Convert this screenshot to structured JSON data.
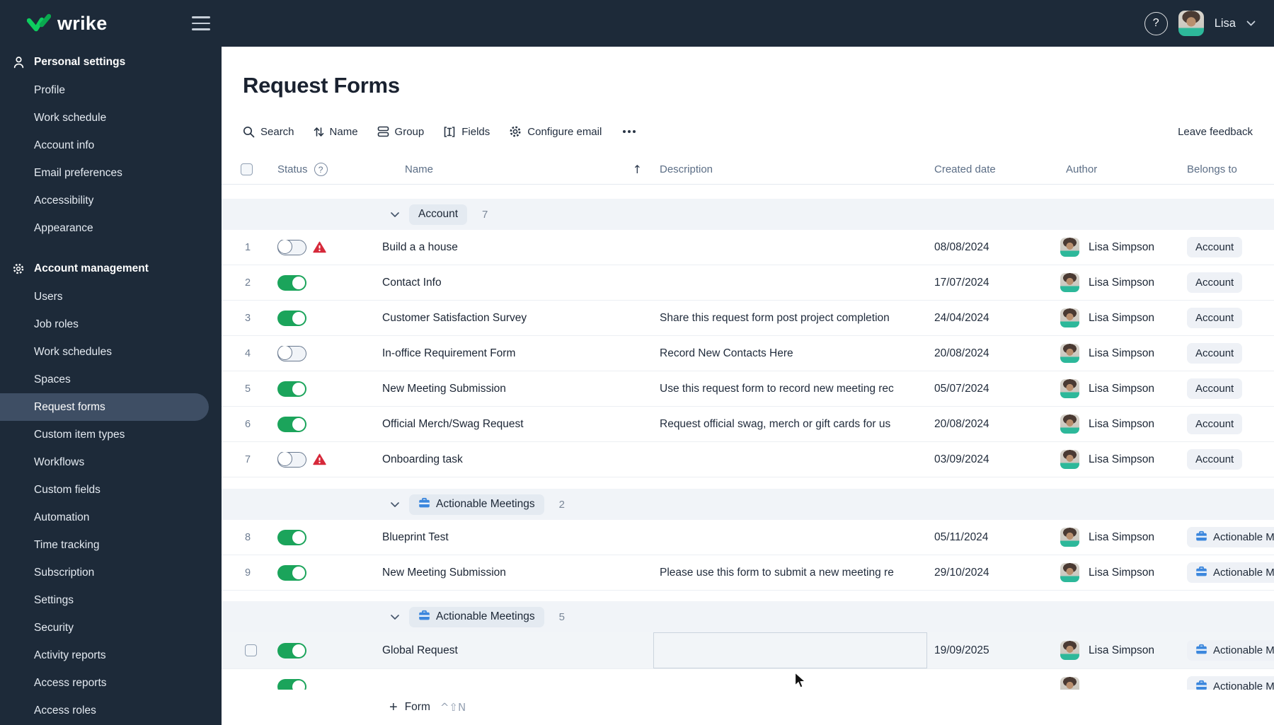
{
  "topbar": {
    "brand": "wrike",
    "user_name": "Lisa",
    "help_icon": "question-circle-icon",
    "menu_icon": "hamburger-icon"
  },
  "sidebar": {
    "sections": [
      {
        "title": "Personal settings",
        "icon": "person-icon",
        "items": [
          {
            "label": "Profile"
          },
          {
            "label": "Work schedule"
          },
          {
            "label": "Account info"
          },
          {
            "label": "Email preferences"
          },
          {
            "label": "Accessibility"
          },
          {
            "label": "Appearance"
          }
        ]
      },
      {
        "title": "Account management",
        "icon": "gear-icon",
        "items": [
          {
            "label": "Users"
          },
          {
            "label": "Job roles"
          },
          {
            "label": "Work schedules"
          },
          {
            "label": "Spaces"
          },
          {
            "label": "Request forms",
            "active": true
          },
          {
            "label": "Custom item types"
          },
          {
            "label": "Workflows"
          },
          {
            "label": "Custom fields"
          },
          {
            "label": "Automation"
          },
          {
            "label": "Time tracking"
          },
          {
            "label": "Subscription"
          },
          {
            "label": "Settings"
          },
          {
            "label": "Security"
          },
          {
            "label": "Activity reports"
          },
          {
            "label": "Access reports"
          },
          {
            "label": "Access roles"
          }
        ]
      }
    ]
  },
  "main": {
    "title": "Request Forms",
    "toolbar": {
      "search": "Search",
      "sort": "Name",
      "group": "Group",
      "fields": "Fields",
      "configure_email": "Configure email",
      "more": "more-options",
      "feedback": "Leave feedback"
    }
  },
  "table": {
    "columns": {
      "status": "Status",
      "name": "Name",
      "description": "Description",
      "created": "Created date",
      "author": "Author",
      "belongs": "Belongs to"
    },
    "sort_arrow": "↑",
    "groups": [
      {
        "label": "Account",
        "count": "7",
        "icon": null,
        "gap": "gap20",
        "rows": [
          {
            "num": "1",
            "toggle": false,
            "warning": true,
            "name": "Build a a house",
            "desc": "",
            "date": "08/08/2024",
            "author": "Lisa Simpson",
            "belongs": "Account",
            "belongs_icon": false
          },
          {
            "num": "2",
            "toggle": true,
            "warning": false,
            "name": "Contact Info",
            "desc": "",
            "date": "17/07/2024",
            "author": "Lisa Simpson",
            "belongs": "Account",
            "belongs_icon": false
          },
          {
            "num": "3",
            "toggle": true,
            "warning": false,
            "name": "Customer Satisfaction Survey",
            "desc": "Share this request form post project completion",
            "date": "24/04/2024",
            "author": "Lisa Simpson",
            "belongs": "Account",
            "belongs_icon": false
          },
          {
            "num": "4",
            "toggle": false,
            "warning": false,
            "name": "In-office Requirement Form",
            "desc": "Record New Contacts Here",
            "date": "20/08/2024",
            "author": "Lisa Simpson",
            "belongs": "Account",
            "belongs_icon": false
          },
          {
            "num": "5",
            "toggle": true,
            "warning": false,
            "name": "New Meeting Submission",
            "desc": "Use this request form to record new meeting rec",
            "date": "05/07/2024",
            "author": "Lisa Simpson",
            "belongs": "Account",
            "belongs_icon": false
          },
          {
            "num": "6",
            "toggle": true,
            "warning": false,
            "name": "Official Merch/Swag Request",
            "desc": "Request official swag, merch or gift cards for us",
            "date": "20/08/2024",
            "author": "Lisa Simpson",
            "belongs": "Account",
            "belongs_icon": false
          },
          {
            "num": "7",
            "toggle": false,
            "warning": true,
            "name": "Onboarding task",
            "desc": "",
            "date": "03/09/2024",
            "author": "Lisa Simpson",
            "belongs": "Account",
            "belongs_icon": false
          }
        ]
      },
      {
        "label": "Actionable Meetings",
        "count": "2",
        "icon": "briefcase-icon",
        "gap": "gap16",
        "rows": [
          {
            "num": "8",
            "toggle": true,
            "warning": false,
            "name": "Blueprint Test",
            "desc": "",
            "date": "05/11/2024",
            "author": "Lisa Simpson",
            "belongs": "Actionable Meetings",
            "belongs_icon": true
          },
          {
            "num": "9",
            "toggle": true,
            "warning": false,
            "name": "New Meeting Submission",
            "desc": "Please use this form to submit a new meeting re",
            "date": "29/10/2024",
            "author": "Lisa Simpson",
            "belongs": "Actionable Meetings",
            "belongs_icon": true
          }
        ]
      },
      {
        "label": "Actionable Meetings",
        "count": "5",
        "icon": "briefcase-icon",
        "gap": "gap15",
        "rows": [
          {
            "checkbox": true,
            "hover": true,
            "toggle": true,
            "warning": false,
            "name": "Global Request",
            "desc": "",
            "desc_boxed": true,
            "date": "19/09/2025",
            "author": "Lisa Simpson",
            "belongs": "Actionable Meetings",
            "belongs_icon": true
          },
          {
            "partial": true,
            "toggle": true,
            "warning": false,
            "name": "",
            "desc": "",
            "date": "",
            "author": "",
            "belongs": "Actionable Meetings",
            "belongs_icon": true
          }
        ]
      }
    ]
  },
  "footer": {
    "form_label": "Form",
    "plus": "+",
    "shortcut": "^⇧N"
  },
  "colors": {
    "topbar_bg": "#1D2A39",
    "selected_item": "#3E4E64",
    "toggle_on": "#1BA45B",
    "warning_red": "#D6293A",
    "brand_green": "#0ECC5F",
    "briefcase_blue": "#3C87DD",
    "group_row_bg": "#F1F4F8"
  }
}
